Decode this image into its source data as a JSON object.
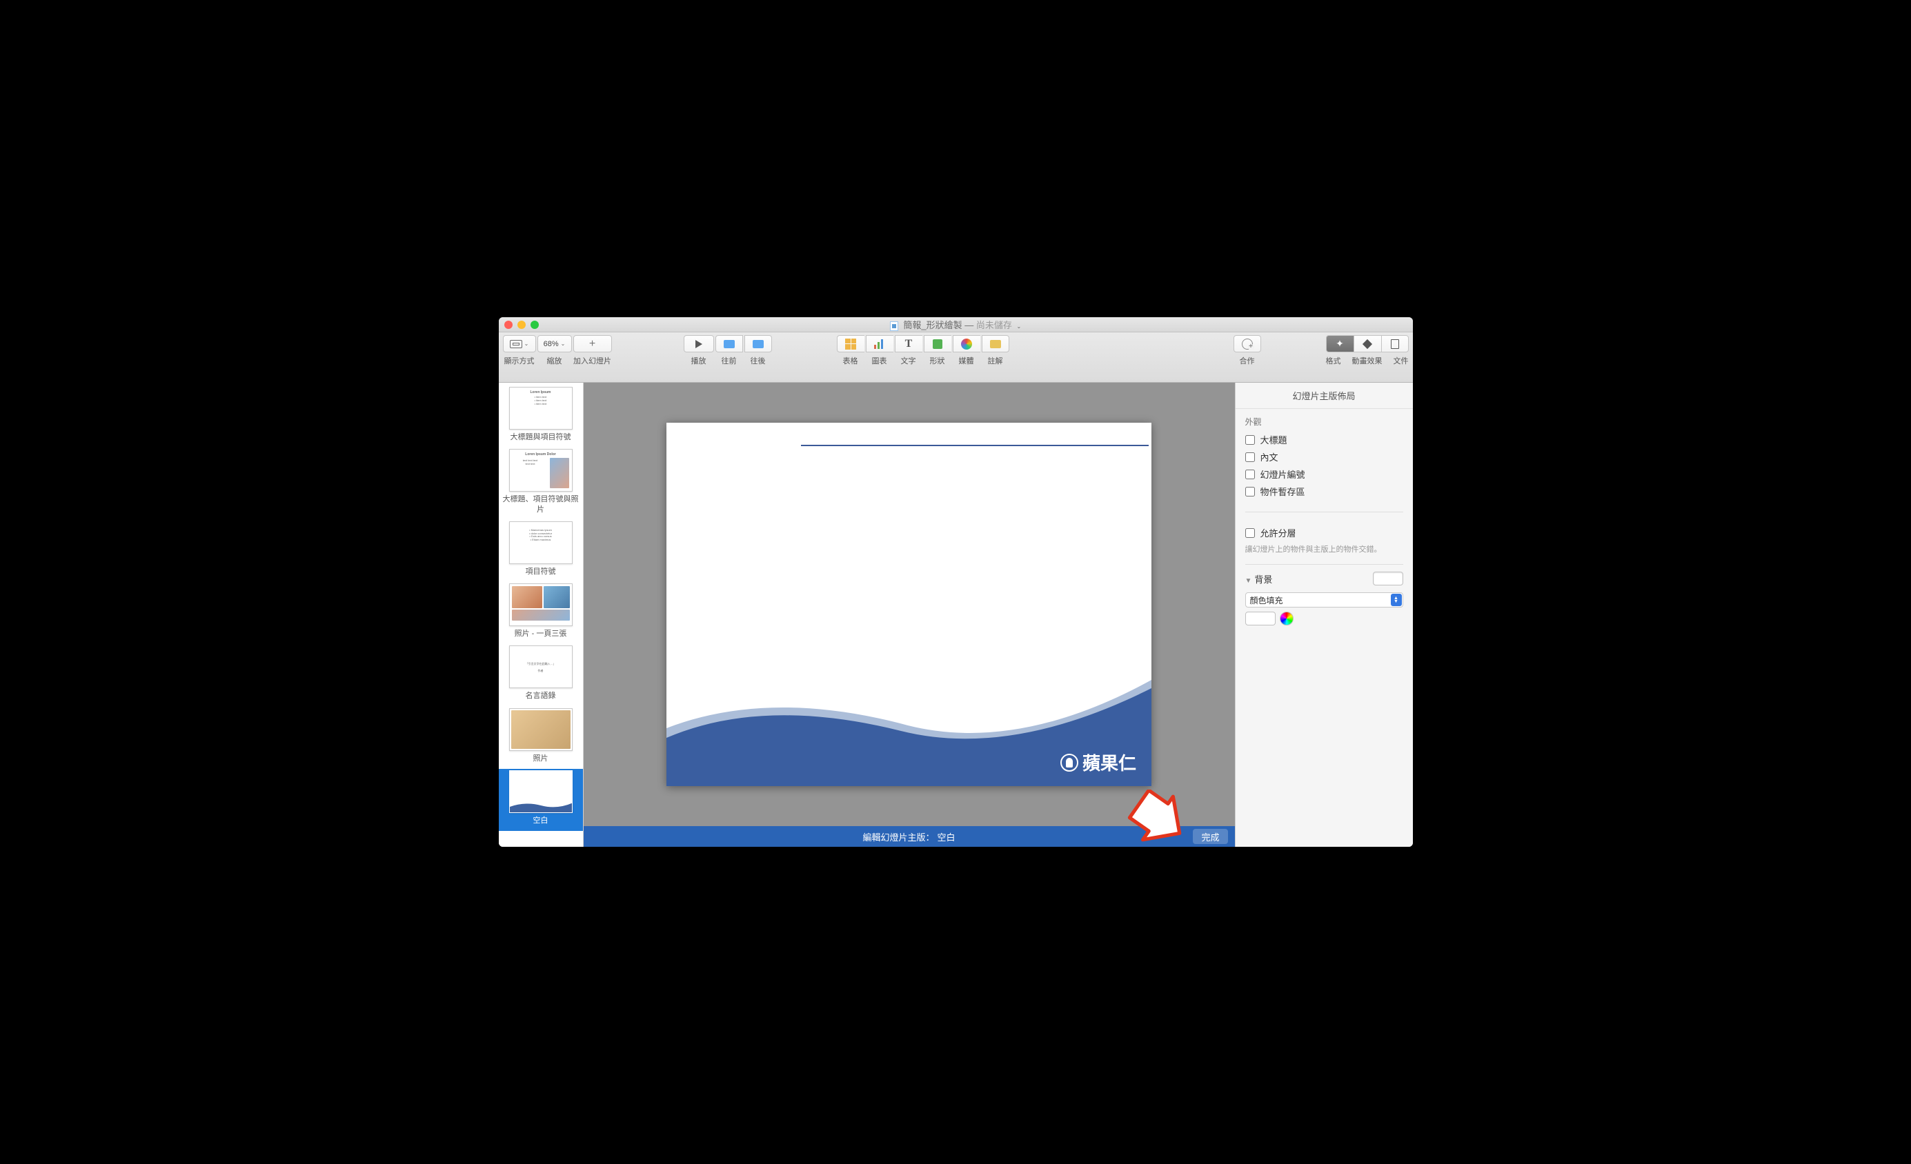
{
  "title": {
    "main": "簡報_形狀繪製",
    "sub": "尚未儲存"
  },
  "toolbar": {
    "view": "顯示方式",
    "zoom": "縮放",
    "zoom_val": "68%",
    "add": "加入幻燈片",
    "play": "播放",
    "back": "往前",
    "fwd": "往後",
    "table": "表格",
    "chart": "圖表",
    "text": "文字",
    "shape": "形狀",
    "media": "媒體",
    "comment": "註解",
    "collab": "合作",
    "format": "格式",
    "animate": "動畫效果",
    "document": "文件"
  },
  "thumbs": [
    {
      "name": "大標題與項目符號"
    },
    {
      "name": "大標題、項目符號與照片",
      "tiny": "Loren Ipsum Dolor"
    },
    {
      "name": "項目符號"
    },
    {
      "name": "照片 - 一頁三張"
    },
    {
      "name": "名言語錄"
    },
    {
      "name": "照片"
    },
    {
      "name": "空白"
    }
  ],
  "slide": {
    "logo": "蘋果仁"
  },
  "editbar": {
    "label": "編輯幻燈片主版：",
    "name": "空白",
    "done": "完成"
  },
  "inspector": {
    "title": "幻燈片主版佈局",
    "appearance": "外觀",
    "cb_title": "大標題",
    "cb_body": "內文",
    "cb_num": "幻燈片編號",
    "cb_placeholder": "物件暫存區",
    "cb_layer": "允許分層",
    "layer_note": "讓幻燈片上的物件與主版上的物件交錯。",
    "background": "背景",
    "fill": "顏色填充"
  }
}
